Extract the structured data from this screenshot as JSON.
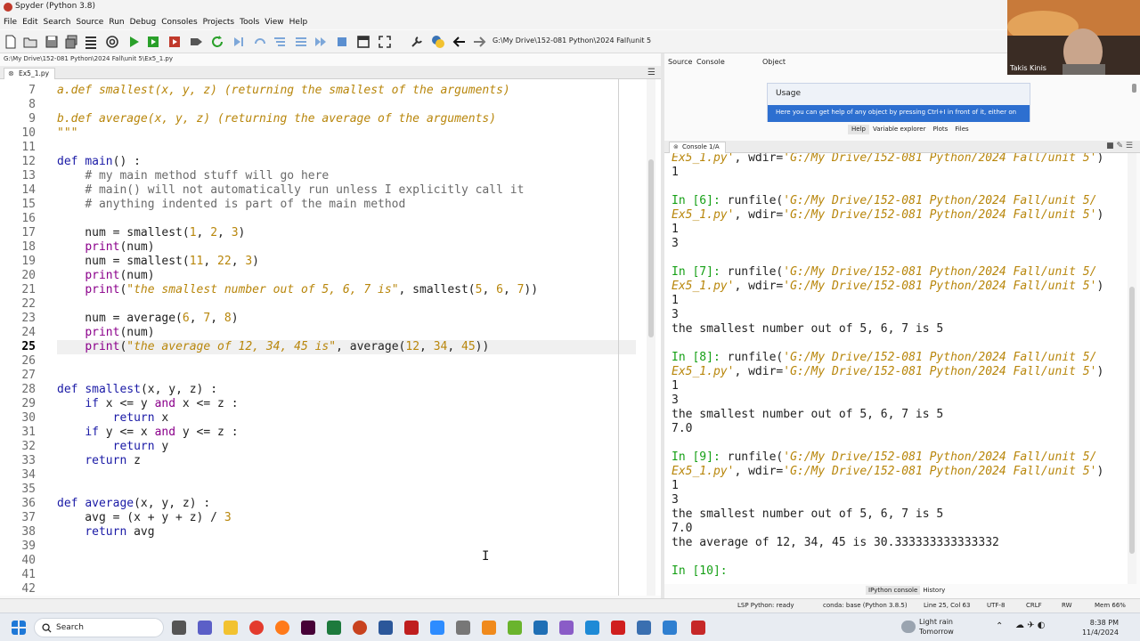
{
  "window": {
    "title": "Spyder (Python 3.8)"
  },
  "menu": [
    "File",
    "Edit",
    "Search",
    "Source",
    "Run",
    "Debug",
    "Consoles",
    "Projects",
    "Tools",
    "View",
    "Help"
  ],
  "toolbar": {
    "path": "G:\\My Drive\\152-081 Python\\2024 Fall\\unit 5"
  },
  "editor": {
    "file_path": "G:\\My Drive\\152-081 Python\\2024 Fall\\unit 5\\Ex5_1.py",
    "tab_label": "Ex5_1.py",
    "line_numbers": [
      "7",
      "8",
      "9",
      "10",
      "11",
      "12",
      "13",
      "14",
      "15",
      "16",
      "17",
      "18",
      "19",
      "20",
      "21",
      "22",
      "23",
      "24",
      "25",
      "26",
      "27",
      "28",
      "29",
      "30",
      "31",
      "32",
      "33",
      "34",
      "35",
      "36",
      "37",
      "38",
      "39",
      "40",
      "41",
      "42"
    ],
    "current_line": "25"
  },
  "help": {
    "source_label": "Source",
    "source_value": "Console",
    "object_label": "Object",
    "usage_title": "Usage",
    "usage_text": "Here you can get help of any object by pressing Ctrl+I in front of it, either on",
    "tabs": [
      "Help",
      "Variable explorer",
      "Plots",
      "Files"
    ]
  },
  "console": {
    "tab_label": "Console 1/A",
    "bottom_tabs": [
      "IPython console",
      "History"
    ]
  },
  "statusbar": {
    "lsp": "LSP Python: ready",
    "conda": "conda: base (Python 3.8.5)",
    "position": "Line 25, Col 63",
    "encoding": "UTF-8",
    "eol": "CRLF",
    "mode": "RW",
    "memory": "Mem 66%"
  },
  "taskbar": {
    "search": "Search",
    "weather_line1": "Light rain",
    "weather_line2": "Tomorrow",
    "time": "8:38 PM",
    "date": "11/4/2024"
  },
  "webcam": {
    "name": "Takis Kinis"
  }
}
